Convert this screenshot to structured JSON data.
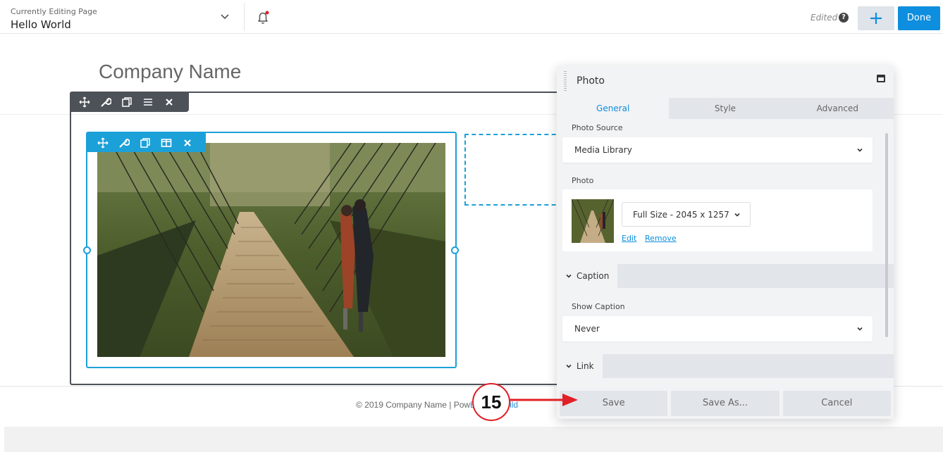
{
  "topbar": {
    "currently_editing_label": "Currently Editing Page",
    "page_title": "Hello World",
    "edited_label": "Edited",
    "help_glyph": "?",
    "done_label": "Done",
    "notification_dot_color": "#e02026"
  },
  "page": {
    "company_name": "Company Name",
    "footer_prefix": "© 2019 Company Name | Pow",
    "footer_link": "Beaver Build"
  },
  "panel": {
    "title": "Photo",
    "tabs": [
      {
        "label": "General",
        "active": true
      },
      {
        "label": "Style",
        "active": false
      },
      {
        "label": "Advanced",
        "active": false
      }
    ],
    "photo_source_label": "Photo Source",
    "photo_source_value": "Media Library",
    "photo_label": "Photo",
    "photo_size_value": "Full Size - 2045 x 1257",
    "edit_link": "Edit",
    "remove_link": "Remove",
    "caption_section": "Caption",
    "show_caption_label": "Show Caption",
    "show_caption_value": "Never",
    "link_section": "Link",
    "buttons": {
      "save": "Save",
      "save_as": "Save As...",
      "cancel": "Cancel"
    }
  },
  "annotation": {
    "step_number": "15",
    "color": "#e02026"
  },
  "colors": {
    "accent": "#1ca0d8",
    "primary_button": "#0d8ede",
    "row_toolbar": "#4d5158"
  }
}
